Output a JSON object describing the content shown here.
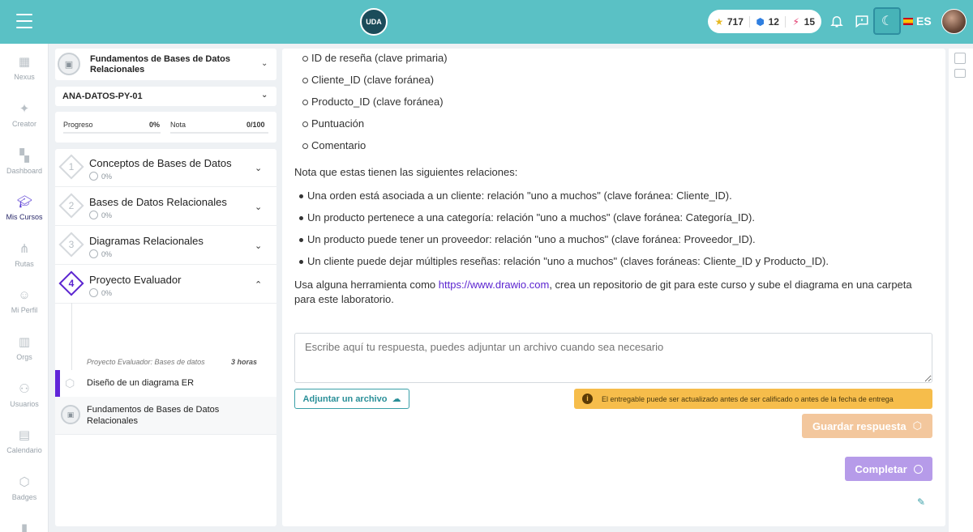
{
  "header": {
    "logo_text": "UDA",
    "stats": {
      "stars": "717",
      "gems": "12",
      "energy": "15"
    },
    "language": "ES"
  },
  "leftnav": {
    "items": [
      {
        "label": "Nexus"
      },
      {
        "label": "Creator"
      },
      {
        "label": "Dashboard"
      },
      {
        "label": "Mis Cursos"
      },
      {
        "label": "Rutas"
      },
      {
        "label": "Mi Perfil"
      },
      {
        "label": "Orgs"
      },
      {
        "label": "Usuarios"
      },
      {
        "label": "Calendario"
      },
      {
        "label": "Badges"
      }
    ]
  },
  "course": {
    "title": "Fundamentos de Bases de Datos Relacionales",
    "code": "ANA-DATOS-PY-01",
    "progress_label": "Progreso",
    "progress_value": "0%",
    "grade_label": "Nota",
    "grade_value": "0/100",
    "units": [
      {
        "num": "1",
        "title": "Conceptos de Bases de Datos",
        "progress": "0%"
      },
      {
        "num": "2",
        "title": "Bases de Datos Relacionales",
        "progress": "0%"
      },
      {
        "num": "3",
        "title": "Diagramas Relacionales",
        "progress": "0%"
      },
      {
        "num": "4",
        "title": "Proyecto Evaluador",
        "progress": "0%"
      }
    ],
    "lesson_meta": "Proyecto Evaluador: Bases de datos",
    "lesson_hours": "3 horas",
    "lesson_title": "Diseño de un diagrama ER",
    "lesson2_title": "Fundamentos de Bases de Datos Relacionales"
  },
  "content": {
    "fields": [
      "ID de reseña (clave primaria)",
      "Cliente_ID (clave foránea)",
      "Producto_ID (clave foránea)",
      "Puntuación",
      "Comentario"
    ],
    "relations_intro": "Nota que estas tienen las siguientes relaciones:",
    "relations": [
      "Una orden está asociada a un cliente: relación \"uno a muchos\" (clave foránea: Cliente_ID).",
      "Un producto pertenece a una categoría: relación \"uno a muchos\" (clave foránea: Categoría_ID).",
      "Un producto puede tener un proveedor: relación \"uno a muchos\" (clave foránea: Proveedor_ID).",
      "Un cliente puede dejar múltiples reseñas: relación \"uno a muchos\" (claves foráneas: Cliente_ID y Producto_ID)."
    ],
    "instruction_pre": "Usa alguna herramienta como ",
    "instruction_link": "https://www.drawio.com",
    "instruction_post": ", crea un repositorio de git para este curso y sube el diagrama en una carpeta para este laboratorio."
  },
  "answer": {
    "placeholder": "Escribe aquí tu respuesta, puedes adjuntar un archivo cuando sea necesario",
    "attach_label": "Adjuntar un archivo",
    "warning": "El entregable puede ser actualizado antes de ser calificado o antes de la fecha de entrega",
    "save_label": "Guardar respuesta",
    "complete_label": "Completar"
  },
  "colors": {
    "topbar": "#5ac1c5",
    "accent": "#5b24d0",
    "warning": "#f6bd4b",
    "save": "#f3c79d",
    "complete": "#b69be9"
  }
}
